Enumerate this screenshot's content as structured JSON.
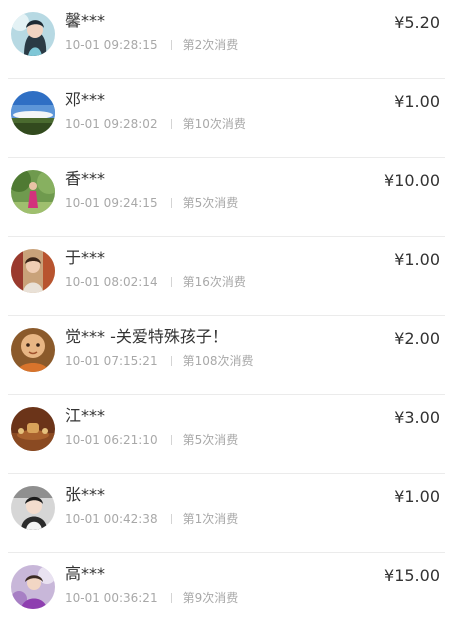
{
  "records": [
    {
      "name": "馨***",
      "time": "10-01 09:28:15",
      "count": "第2次消费",
      "amount": "¥5.20",
      "avatar_icon": "woman-portrait-avatar"
    },
    {
      "name": "邓***",
      "time": "10-01 09:28:02",
      "count": "第10次消费",
      "amount": "¥1.00",
      "avatar_icon": "sky-landscape-avatar"
    },
    {
      "name": "香***",
      "time": "10-01 09:24:15",
      "count": "第5次消费",
      "amount": "¥10.00",
      "avatar_icon": "garden-person-avatar"
    },
    {
      "name": "于***",
      "time": "10-01 08:02:14",
      "count": "第16次消费",
      "amount": "¥1.00",
      "avatar_icon": "woman-indoor-avatar"
    },
    {
      "name": "觉*** -关爱特殊孩子！",
      "time": "10-01 07:15:21",
      "count": "第108次消费",
      "amount": "¥2.00",
      "avatar_icon": "monk-figure-avatar"
    },
    {
      "name": "江***",
      "time": "10-01 06:21:10",
      "count": "第5次消费",
      "amount": "¥3.00",
      "avatar_icon": "tea-set-avatar"
    },
    {
      "name": "张***",
      "time": "10-01 00:42:38",
      "count": "第1次消费",
      "amount": "¥1.00",
      "avatar_icon": "woman-car-avatar"
    },
    {
      "name": "高***",
      "time": "10-01 00:36:21",
      "count": "第9次消费",
      "amount": "¥15.00",
      "avatar_icon": "woman-flowers-avatar"
    }
  ]
}
